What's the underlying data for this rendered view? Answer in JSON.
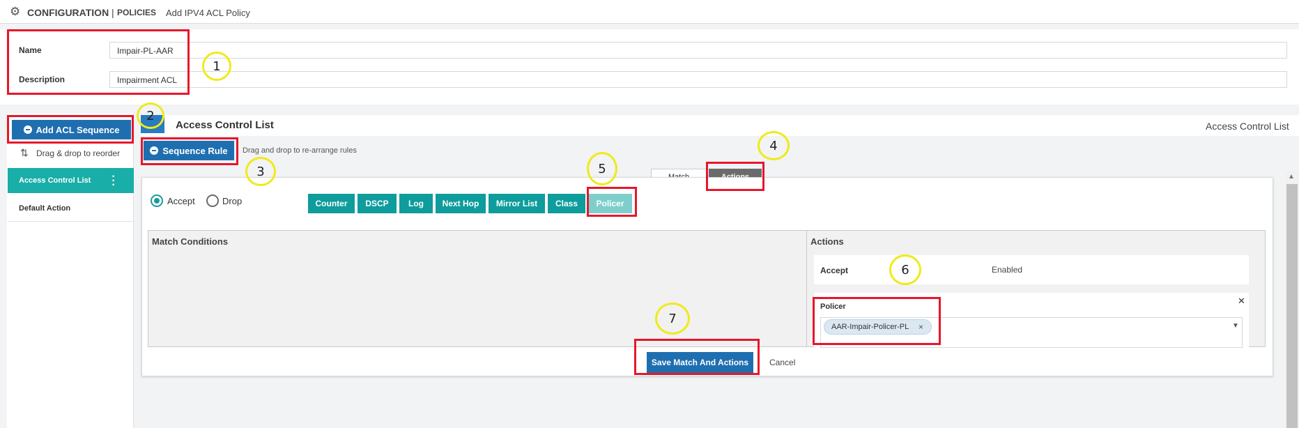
{
  "header": {
    "title": "CONFIGURATION",
    "separator": "|",
    "section": "POLICIES",
    "breadcrumb": "Add IPV4 ACL Policy"
  },
  "form": {
    "name_label": "Name",
    "name_value": "Impair-PL-AAR",
    "description_label": "Description",
    "description_value": "Impairment ACL"
  },
  "sidebar": {
    "add_button": "Add ACL Sequence",
    "drag_hint": "Drag & drop to reorder",
    "items": [
      {
        "label": "Access Control List",
        "active": true
      },
      {
        "label": "Default Action",
        "active": false
      }
    ]
  },
  "main": {
    "title": "Access Control List",
    "title_right": "Access Control List",
    "sequence_rule_button": "Sequence Rule",
    "drag_hint": "Drag and drop to re-arrange rules",
    "tabs": [
      {
        "label": "Match",
        "active": false
      },
      {
        "label": "Actions",
        "active": true
      }
    ],
    "radio_accept": "Accept",
    "radio_drop": "Drop",
    "action_buttons": [
      "Counter",
      "DSCP",
      "Log",
      "Next Hop",
      "Mirror List",
      "Class",
      "Policer"
    ],
    "match_conditions_label": "Match Conditions",
    "actions_label": "Actions",
    "accept_row": {
      "label": "Accept",
      "value": "Enabled"
    },
    "policer": {
      "label": "Policer",
      "tag": "AAR-Impair-Policer-PL",
      "tag_remove": "×",
      "close": "✕"
    },
    "save_button": "Save Match And Actions",
    "cancel_button": "Cancel"
  },
  "annotations": [
    "1",
    "2",
    "3",
    "4",
    "5",
    "6",
    "7"
  ],
  "colors": {
    "primary_blue": "#1f6fb0",
    "teal": "#0e9c9c",
    "teal_light": "#7ecfcc",
    "sidebar_active": "#1aaea8",
    "annotation_red": "#e8162a",
    "annotation_yellow": "#f0ea1a"
  }
}
